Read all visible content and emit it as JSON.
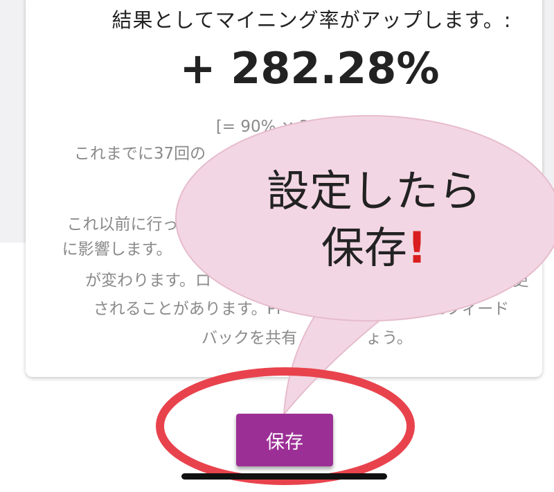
{
  "result": {
    "headline": "結果としてマイニング率がアップします。:",
    "rate": "+ 282.28%"
  },
  "details": {
    "formula": "[= 90% × 200%",
    "line2": "これまでに37回の",
    "line2_tail": "し",
    "line3": "これ以前に行っ",
    "line4": "に影響します。",
    "line5": "が変わります。ロ",
    "line5_tail": "更",
    "line6": "されることがあります。Pi",
    "line6_tail": "にフィード",
    "line7": "バックを共有",
    "line7_tail": "ょう。"
  },
  "annotation": {
    "line1": "設定したら",
    "line2": "保存",
    "mark": "!",
    "bubble_color": "#f3d6e3",
    "circle_color": "#e8434d"
  },
  "actions": {
    "save_label": "保存",
    "accent": "#9c2f96"
  }
}
